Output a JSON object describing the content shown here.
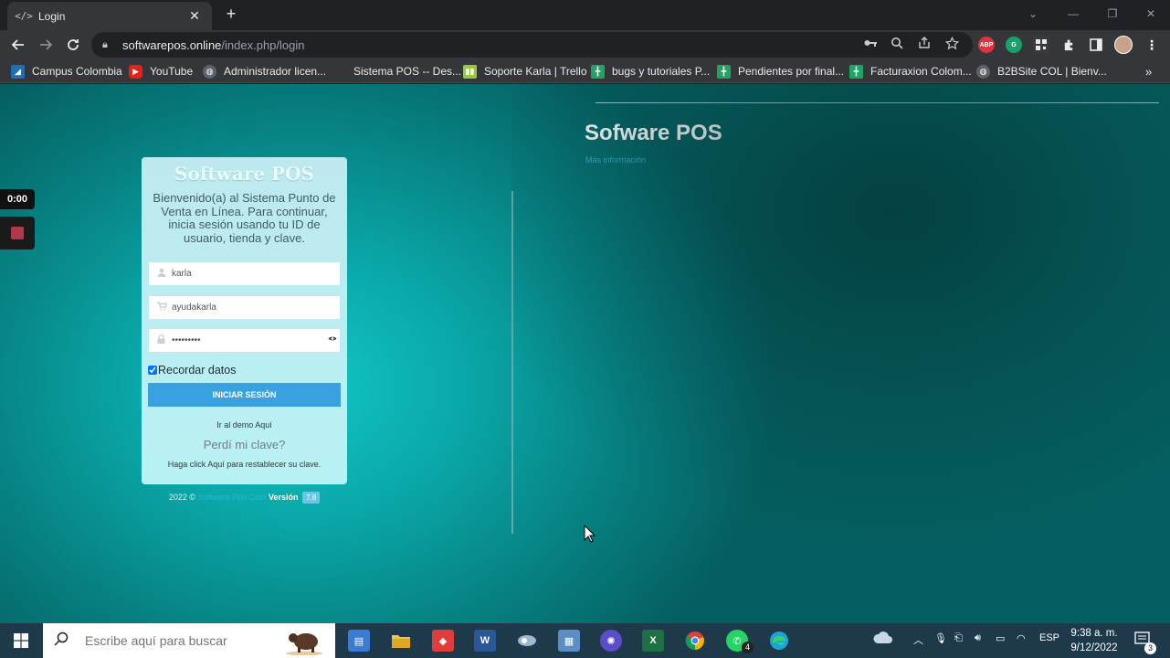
{
  "browser": {
    "tab_title": "Login",
    "tab_icon": "</>",
    "url_host": "softwarepos.online",
    "url_path": "/index.php/login",
    "extensions": [
      "ABP",
      "G",
      "QR",
      "puzzle",
      "sidebar"
    ]
  },
  "bookmarks": [
    {
      "label": "Campus Colombia",
      "color": "#1f6fb2"
    },
    {
      "label": "YouTube",
      "color": "#e62117"
    },
    {
      "label": "Administrador licen...",
      "color": "#5f6368"
    },
    {
      "label": "Sistema POS -- Des...",
      "color": "#35363a"
    },
    {
      "label": "Soporte Karla | Trello",
      "color": "#9ac93c"
    },
    {
      "label": "bugs y tutoriales P...",
      "color": "#1fa463"
    },
    {
      "label": "Pendientes por final...",
      "color": "#1fa463"
    },
    {
      "label": "Facturaxion Colom...",
      "color": "#1fa463"
    },
    {
      "label": "B2BSite COL | Bienv...",
      "color": "#5f6368"
    }
  ],
  "recorder": {
    "time": "0:00"
  },
  "login": {
    "brand": "Software POS",
    "welcome": "Bienvenido(a) al Sistema Punto de Venta en Línea. Para continuar, inicia sesión usando tu ID de usuario, tienda y clave.",
    "user_value": "karla",
    "store_value": "ayudakarla",
    "password_value": "123456789",
    "remember_label": "Recordar datos",
    "remember_checked": true,
    "submit_label": "INICIAR SESIÓN",
    "demo_text": "Ir al demo Aquí",
    "forgot_text": "Perdí mi clave?",
    "help_text": "Haga click Aquí para restablecer su clave."
  },
  "footer": {
    "year": "2022 ©",
    "brand_link": "Software Pos Com",
    "version_label": "Versión",
    "version": "7.8"
  },
  "hero": {
    "title": "Sofware POS",
    "more_link": "Más información"
  },
  "taskbar": {
    "search_placeholder": "Escribe aquí para buscar",
    "whatsapp_badge": "4",
    "language": "ESP",
    "time": "9:38 a. m.",
    "date": "9/12/2022",
    "notification_count": "3"
  }
}
